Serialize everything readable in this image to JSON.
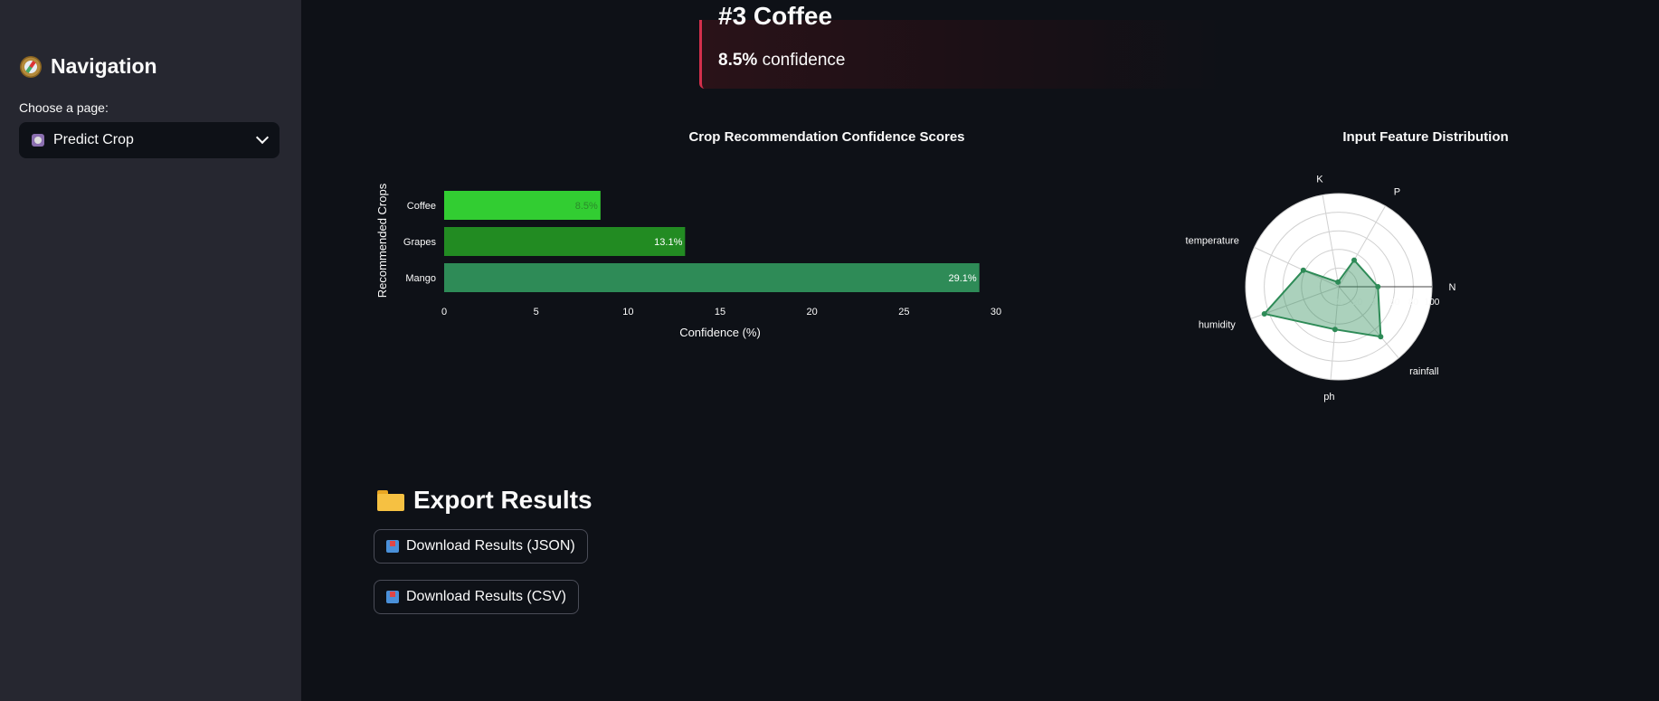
{
  "sidebar": {
    "title": "Navigation",
    "choose_label": "Choose a page:",
    "selected_page": "Predict Crop",
    "icons": {
      "title": "compass-icon",
      "page": "crystal-ball-icon",
      "dropdown": "chevron-down-icon"
    }
  },
  "result_card": {
    "title": "#3 Coffee",
    "confidence_value": "8.5%",
    "confidence_suffix": "confidence",
    "accent_color": "#d32f4b"
  },
  "export": {
    "title": "Export Results",
    "json_button": "Download Results (JSON)",
    "csv_button": "Download Results (CSV)",
    "icons": {
      "title": "folder-icon",
      "button": "inbox-tray-icon"
    }
  },
  "chart_data": [
    {
      "type": "bar",
      "orientation": "horizontal",
      "title": "Crop Recommendation Confidence Scores",
      "xlabel": "Confidence (%)",
      "ylabel": "Recommended Crops",
      "categories": [
        "Coffee",
        "Grapes",
        "Mango"
      ],
      "values": [
        8.5,
        13.1,
        29.1
      ],
      "data_labels": [
        "8.5%",
        "13.1%",
        "29.1%"
      ],
      "colors": [
        "#32cd32",
        "#228b22",
        "#2e8b57"
      ],
      "label_colors": [
        "#2a8a2a",
        "#ffffff",
        "#ffffff"
      ],
      "xlim": [
        0,
        30
      ],
      "xticks": [
        0,
        5,
        10,
        15,
        20,
        25,
        30
      ],
      "grid": false
    },
    {
      "type": "radar",
      "title": "Input Feature Distribution",
      "axes": [
        "N",
        "P",
        "K",
        "temperature",
        "humidity",
        "ph",
        "rainfall"
      ],
      "axis_angles_deg": [
        0,
        60,
        100,
        155,
        200,
        265,
        310
      ],
      "values": [
        42,
        33,
        5,
        42,
        85,
        46,
        70
      ],
      "rlim": [
        0,
        100
      ],
      "rticks": [
        "0",
        "20",
        "40",
        "60",
        "80",
        "100"
      ],
      "line_color": "#2e8b57",
      "fill_color": "#2e8b57"
    }
  ]
}
